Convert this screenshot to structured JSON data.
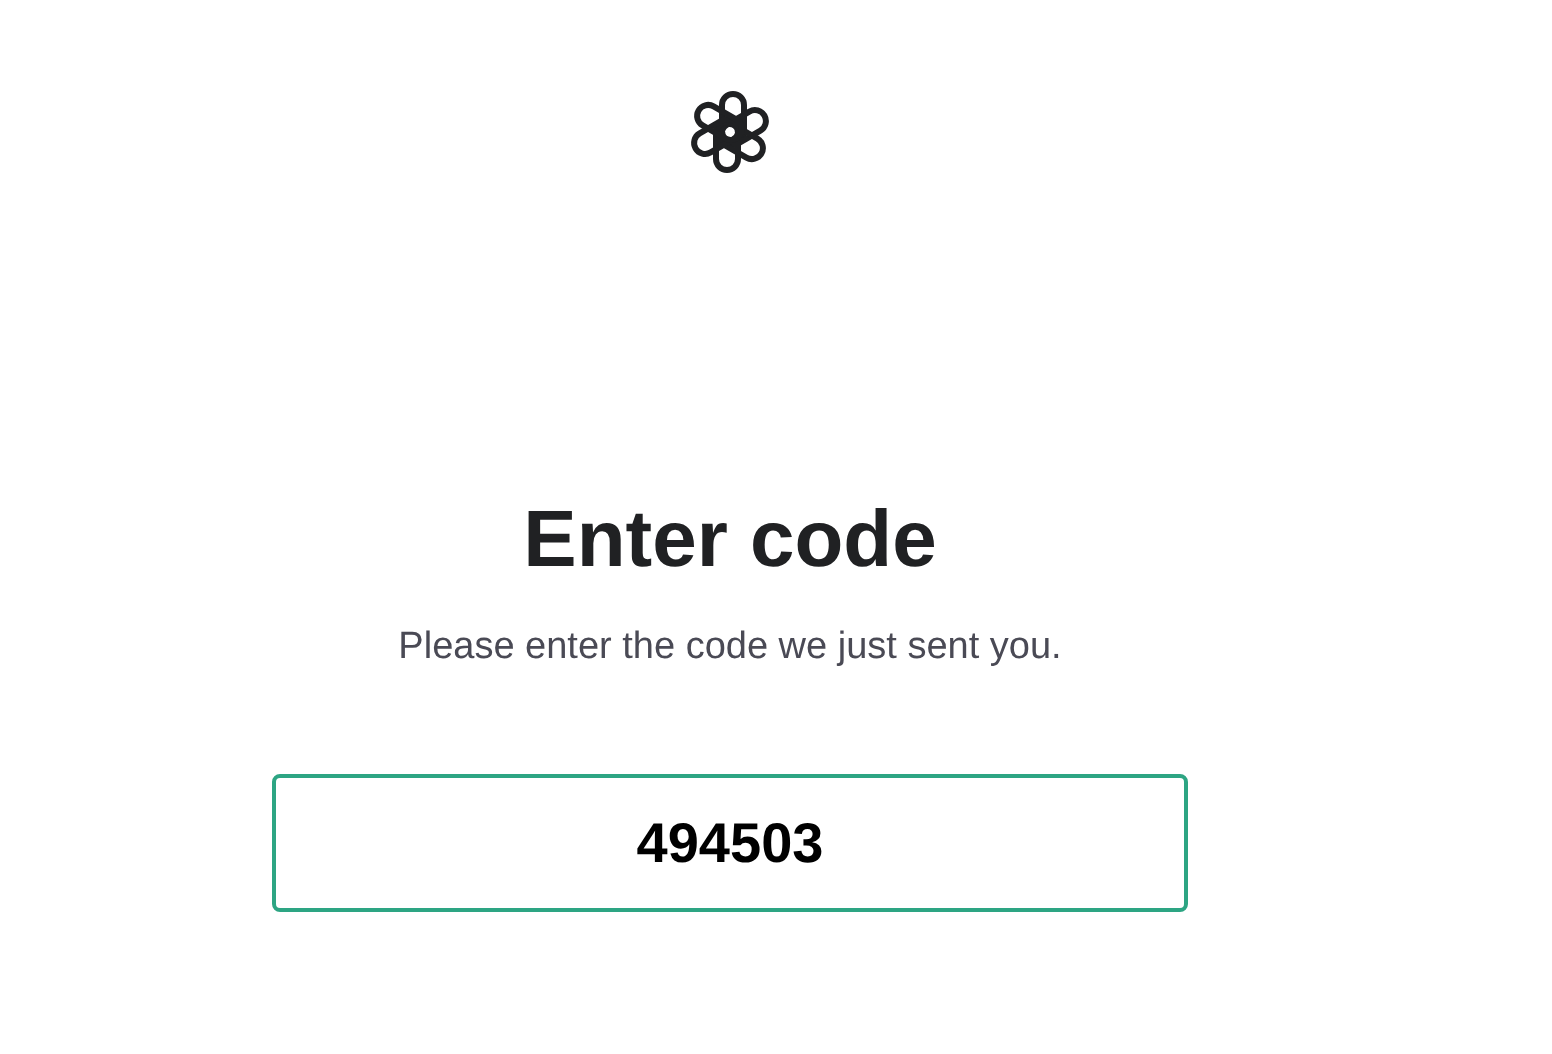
{
  "title": "Enter code",
  "subtitle": "Please enter the code we just sent you.",
  "code_field": {
    "value": "494503",
    "focused": true
  }
}
